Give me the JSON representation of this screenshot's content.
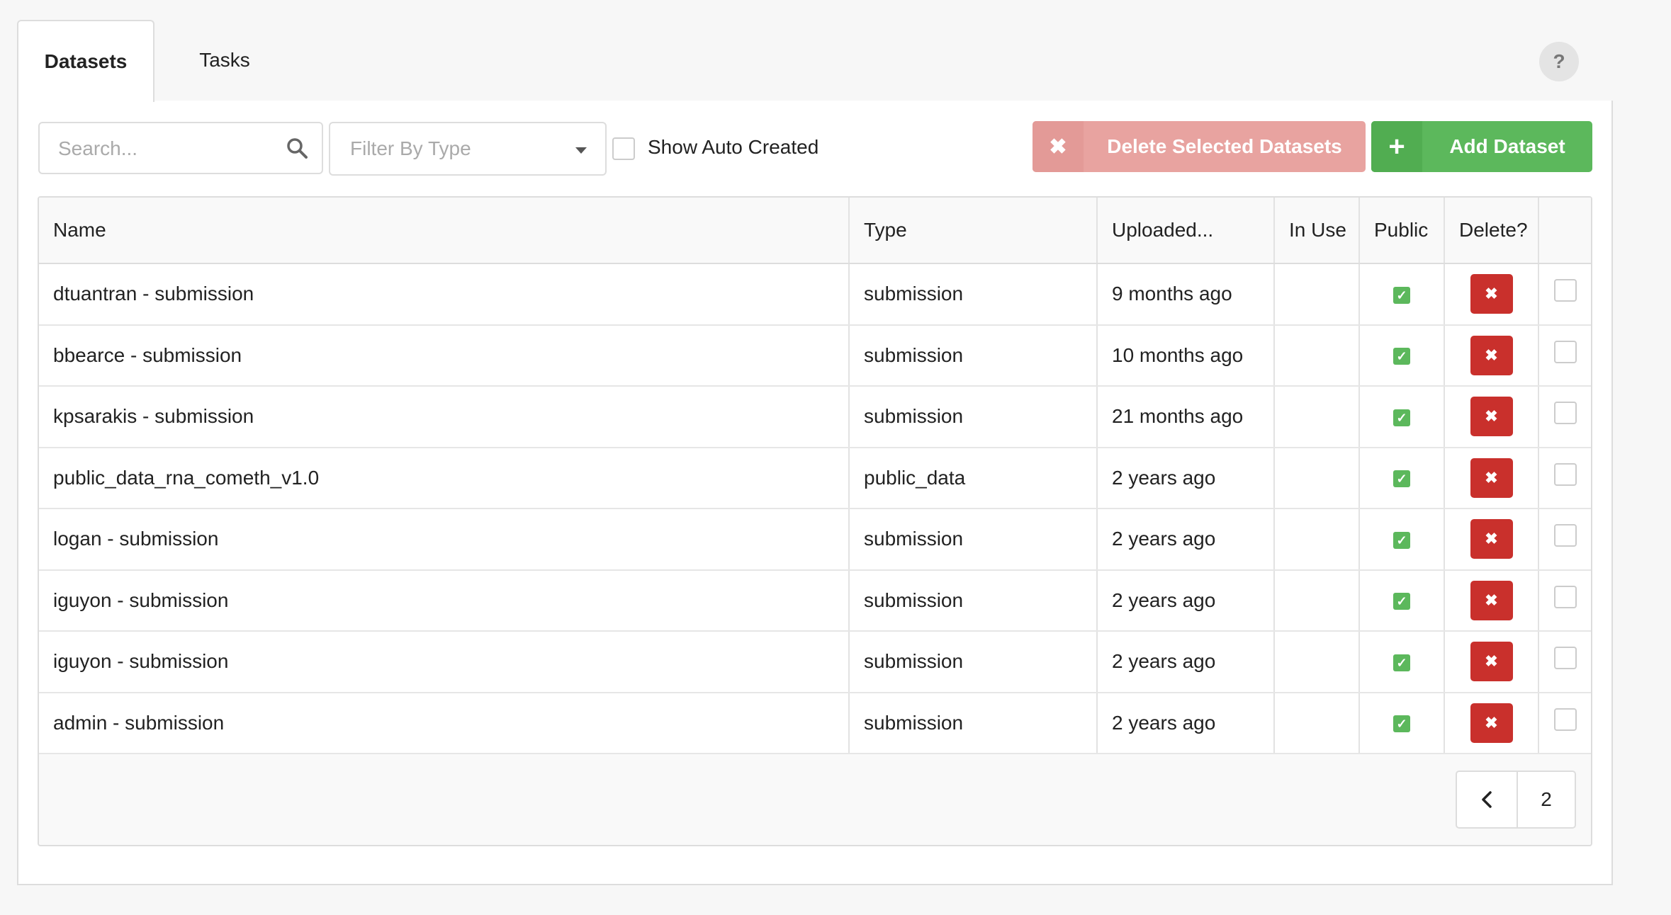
{
  "tabs": {
    "datasets": "Datasets",
    "tasks": "Tasks"
  },
  "help_label": "?",
  "toolbar": {
    "search_placeholder": "Search...",
    "filter_placeholder": "Filter By Type",
    "show_auto_created": "Show Auto Created",
    "delete_selected": "Delete Selected Datasets",
    "add_dataset": "Add Dataset"
  },
  "table": {
    "headers": {
      "name": "Name",
      "type": "Type",
      "uploaded": "Uploaded...",
      "in_use": "In Use",
      "public": "Public",
      "delete": "Delete?"
    },
    "rows": [
      {
        "name": "dtuantran - submission",
        "type": "submission",
        "uploaded": "9 months ago",
        "in_use": "",
        "public": true
      },
      {
        "name": "bbearce - submission",
        "type": "submission",
        "uploaded": "10 months ago",
        "in_use": "",
        "public": true
      },
      {
        "name": "kpsarakis - submission",
        "type": "submission",
        "uploaded": "21 months ago",
        "in_use": "",
        "public": true
      },
      {
        "name": "public_data_rna_cometh_v1.0",
        "type": "public_data",
        "uploaded": "2 years ago",
        "in_use": "",
        "public": true
      },
      {
        "name": "logan - submission",
        "type": "submission",
        "uploaded": "2 years ago",
        "in_use": "",
        "public": true
      },
      {
        "name": "iguyon - submission",
        "type": "submission",
        "uploaded": "2 years ago",
        "in_use": "",
        "public": true
      },
      {
        "name": "iguyon - submission",
        "type": "submission",
        "uploaded": "2 years ago",
        "in_use": "",
        "public": true
      },
      {
        "name": "admin - submission",
        "type": "submission",
        "uploaded": "2 years ago",
        "in_use": "",
        "public": true
      }
    ]
  },
  "pagination": {
    "page": "2"
  },
  "colors": {
    "add_green": "#5cb85c",
    "delete_red": "#c9302c",
    "delete_selected_disabled": "#e8a3a0"
  },
  "icons": {
    "search": "search-icon",
    "caret": "caret-down-icon",
    "times": "times-icon",
    "plus": "plus-icon",
    "check": "check-icon",
    "prev": "chevron-left-icon"
  }
}
